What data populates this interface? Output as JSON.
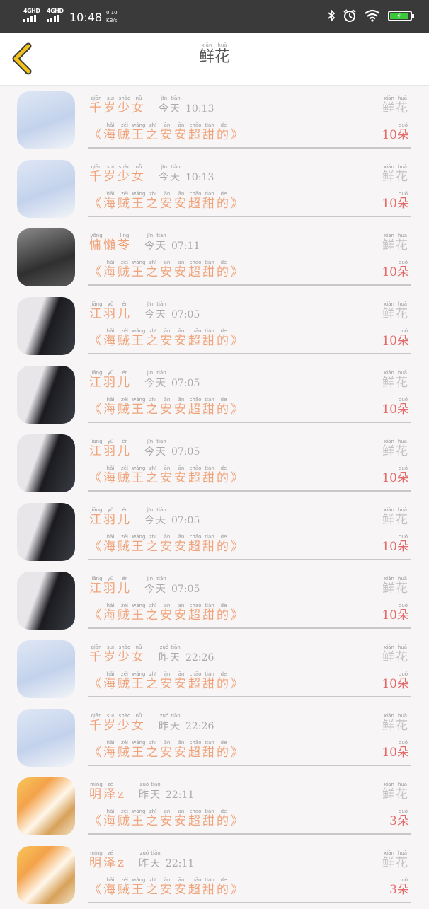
{
  "status_bar": {
    "network1": "4GHD",
    "network2": "4GHD",
    "time": "10:48",
    "speed_value": "0.10",
    "speed_unit": "KB/s"
  },
  "header": {
    "title": "鲜花",
    "title_pinyin": [
      "xiān",
      "huā"
    ]
  },
  "colors": {
    "accent_orange": "#f0a37a",
    "count_red": "#e46a6a",
    "back_icon_yellow": "#f2c01a"
  },
  "list": [
    {
      "avatar": "man",
      "name": "千岁少女",
      "name_pinyin": [
        "qiān",
        "suì",
        "shào",
        "nǚ"
      ],
      "day": "今天",
      "day_pinyin": [
        "jīn",
        "tiān"
      ],
      "time": "10:13",
      "flower_label": "鲜花",
      "flower_pinyin": [
        "xiān",
        "huā"
      ],
      "book": "《海贼王之安安超甜的》",
      "count": "10朵"
    },
    {
      "avatar": "man",
      "name": "千岁少女",
      "name_pinyin": [
        "qiān",
        "suì",
        "shào",
        "nǚ"
      ],
      "day": "今天",
      "day_pinyin": [
        "jīn",
        "tiān"
      ],
      "time": "10:13",
      "flower_label": "鲜花",
      "flower_pinyin": [
        "xiān",
        "huā"
      ],
      "book": "《海贼王之安安超甜的》",
      "count": "10朵"
    },
    {
      "avatar": "girl",
      "name": "慵懶苓",
      "name_pinyin": [
        "yōng",
        "",
        "líng"
      ],
      "day": "今天",
      "day_pinyin": [
        "jīn",
        "tiān"
      ],
      "time": "07:11",
      "flower_label": "鲜花",
      "flower_pinyin": [
        "xiān",
        "huā"
      ],
      "book": "《海贼王之安安超甜的》",
      "count": "10朵"
    },
    {
      "avatar": "hair",
      "name": "江羽儿",
      "name_pinyin": [
        "jiāng",
        "yǔ",
        "ér"
      ],
      "day": "今天",
      "day_pinyin": [
        "jīn",
        "tiān"
      ],
      "time": "07:05",
      "flower_label": "鲜花",
      "flower_pinyin": [
        "xiān",
        "huā"
      ],
      "book": "《海贼王之安安超甜的》",
      "count": "10朵"
    },
    {
      "avatar": "hair",
      "name": "江羽儿",
      "name_pinyin": [
        "jiāng",
        "yǔ",
        "ér"
      ],
      "day": "今天",
      "day_pinyin": [
        "jīn",
        "tiān"
      ],
      "time": "07:05",
      "flower_label": "鲜花",
      "flower_pinyin": [
        "xiān",
        "huā"
      ],
      "book": "《海贼王之安安超甜的》",
      "count": "10朵"
    },
    {
      "avatar": "hair",
      "name": "江羽儿",
      "name_pinyin": [
        "jiāng",
        "yǔ",
        "ér"
      ],
      "day": "今天",
      "day_pinyin": [
        "jīn",
        "tiān"
      ],
      "time": "07:05",
      "flower_label": "鲜花",
      "flower_pinyin": [
        "xiān",
        "huā"
      ],
      "book": "《海贼王之安安超甜的》",
      "count": "10朵"
    },
    {
      "avatar": "hair",
      "name": "江羽儿",
      "name_pinyin": [
        "jiāng",
        "yǔ",
        "ér"
      ],
      "day": "今天",
      "day_pinyin": [
        "jīn",
        "tiān"
      ],
      "time": "07:05",
      "flower_label": "鲜花",
      "flower_pinyin": [
        "xiān",
        "huā"
      ],
      "book": "《海贼王之安安超甜的》",
      "count": "10朵"
    },
    {
      "avatar": "hair",
      "name": "江羽儿",
      "name_pinyin": [
        "jiāng",
        "yǔ",
        "ér"
      ],
      "day": "今天",
      "day_pinyin": [
        "jīn",
        "tiān"
      ],
      "time": "07:05",
      "flower_label": "鲜花",
      "flower_pinyin": [
        "xiān",
        "huā"
      ],
      "book": "《海贼王之安安超甜的》",
      "count": "10朵"
    },
    {
      "avatar": "man",
      "name": "千岁少女",
      "name_pinyin": [
        "qiān",
        "suì",
        "shào",
        "nǚ"
      ],
      "day": "昨天",
      "day_pinyin": [
        "zuó",
        "tiān"
      ],
      "time": "22:26",
      "flower_label": "鲜花",
      "flower_pinyin": [
        "xiān",
        "huā"
      ],
      "book": "《海贼王之安安超甜的》",
      "count": "10朵"
    },
    {
      "avatar": "man",
      "name": "千岁少女",
      "name_pinyin": [
        "qiān",
        "suì",
        "shào",
        "nǚ"
      ],
      "day": "昨天",
      "day_pinyin": [
        "zuó",
        "tiān"
      ],
      "time": "22:26",
      "flower_label": "鲜花",
      "flower_pinyin": [
        "xiān",
        "huā"
      ],
      "book": "《海贼王之安安超甜的》",
      "count": "10朵"
    },
    {
      "avatar": "paint",
      "name": "明泽z",
      "name_pinyin": [
        "míng",
        "zé",
        ""
      ],
      "day": "昨天",
      "day_pinyin": [
        "zuó",
        "tiān"
      ],
      "time": "22:11",
      "flower_label": "鲜花",
      "flower_pinyin": [
        "xiān",
        "huā"
      ],
      "book": "《海贼王之安安超甜的》",
      "count": "3朵"
    },
    {
      "avatar": "paint",
      "name": "明泽z",
      "name_pinyin": [
        "míng",
        "zé",
        ""
      ],
      "day": "昨天",
      "day_pinyin": [
        "zuó",
        "tiān"
      ],
      "time": "22:11",
      "flower_label": "鲜花",
      "flower_pinyin": [
        "xiān",
        "huā"
      ],
      "book": "《海贼王之安安超甜的》",
      "count": "3朵"
    }
  ],
  "book_pinyin": [
    "",
    "hǎi",
    "zéi",
    "wáng",
    "zhī",
    "ān",
    "ān",
    "chāo",
    "tián",
    "de",
    ""
  ],
  "count_pinyin": "duǒ"
}
